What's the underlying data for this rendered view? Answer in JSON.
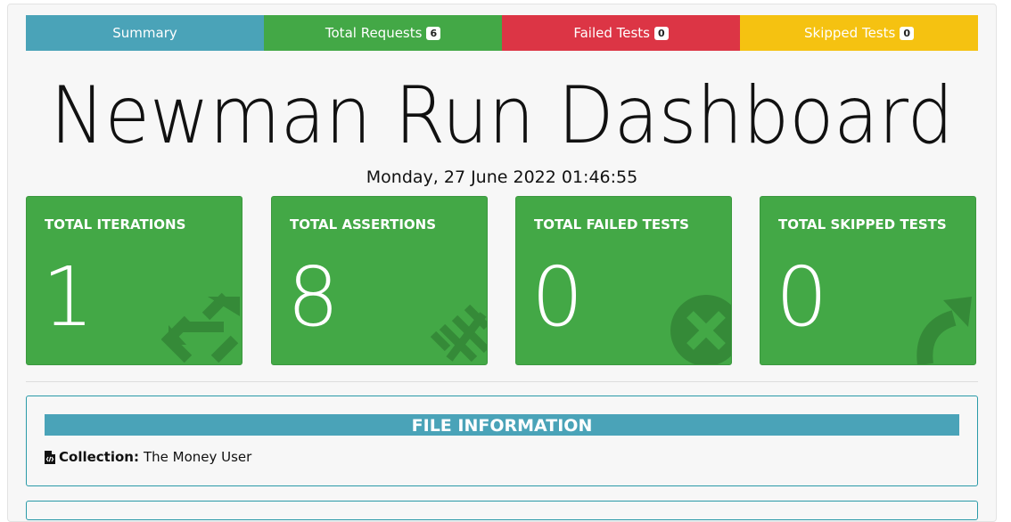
{
  "tabs": [
    {
      "label": "Summary",
      "color": "#4aa3b8",
      "badge": null
    },
    {
      "label": "Total Requests",
      "color": "#43a846",
      "badge": "6"
    },
    {
      "label": "Failed Tests",
      "color": "#dc3545",
      "badge": "0"
    },
    {
      "label": "Skipped Tests",
      "color": "#f5c211",
      "badge": "0"
    }
  ],
  "header": {
    "title": "Newman Run Dashboard",
    "date": "Monday, 27 June 2022 01:46:55"
  },
  "cards": [
    {
      "label": "TOTAL ITERATIONS",
      "value": "1",
      "icon": "refresh-icon"
    },
    {
      "label": "TOTAL ASSERTIONS",
      "value": "8",
      "icon": "assertions-icon"
    },
    {
      "label": "TOTAL FAILED TESTS",
      "value": "0",
      "icon": "times-circle-icon"
    },
    {
      "label": "TOTAL SKIPPED TESTS",
      "value": "0",
      "icon": "share-arrow-icon"
    }
  ],
  "file_info": {
    "heading": "FILE INFORMATION",
    "collection_label": "Collection:",
    "collection_value": "The Money User",
    "icon": "file-code-icon"
  },
  "colors": {
    "card_green": "#43a846",
    "accent_teal": "#4aa3b8"
  }
}
